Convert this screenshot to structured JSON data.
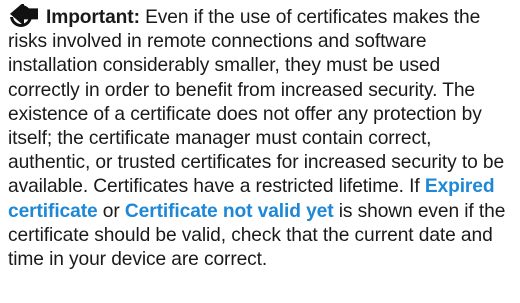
{
  "note": {
    "icon": "warning-arrow-icon",
    "label": "Important:",
    "text_before": " Even if the use of certificates makes the risks involved in remote connections and software installation considerably smaller, they must be used correctly in order to benefit from increased security. The existence of a certificate does not offer any protection by itself; the certificate manager must contain correct, authentic, or trusted certificates for increased security to be available. Certificates have a restricted lifetime. If ",
    "term_expired": "Expired certificate",
    "text_or": " or ",
    "term_not_valid": "Certificate not valid yet",
    "text_after": " is shown even if the certificate should be valid, check that the current date and time in your device are correct."
  },
  "colors": {
    "text": "#1a1a1a",
    "term": "#1e88d6"
  }
}
